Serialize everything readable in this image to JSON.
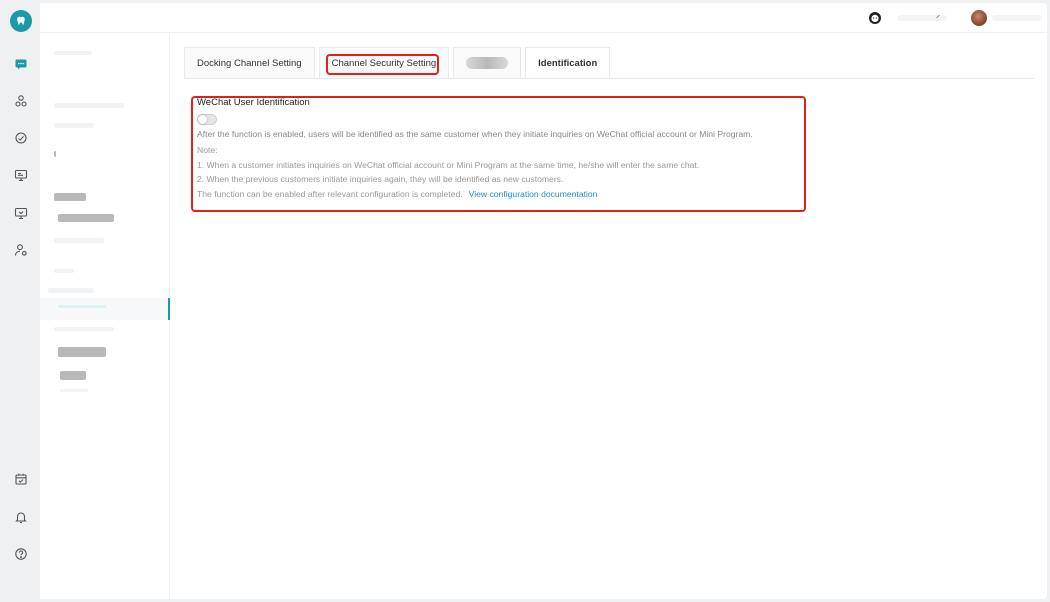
{
  "app": {
    "brand_color": "#1a9aa8",
    "highlight_color": "#e0201b"
  },
  "rail": {
    "icons": [
      "tooth-logo-icon",
      "chat-icon",
      "users-icon",
      "dashboard-icon",
      "monitor-icon",
      "screen-icon",
      "user-settings-icon",
      "calendar-icon",
      "bell-icon",
      "help-icon"
    ]
  },
  "tabs": [
    {
      "label": "Docking Channel Setting"
    },
    {
      "label": "Channel Security Setting"
    },
    {
      "label": ""
    },
    {
      "label": "Identification"
    }
  ],
  "section": {
    "title": "WeChat User Identification",
    "toggle_on": false,
    "description": "After the function is enabled, users will be identified as the same customer when they initiate inquiries on WeChat official account or Mini Program.",
    "note_label": "Note:",
    "notes": [
      "1. When a customer initiates inquiries on WeChat official account or Mini Program at the same time, he/she will enter the same chat.",
      "2. When the previous customers initiate inquiries again, they will be identified as new customers."
    ],
    "footer_text": "The function can be enabled after relevant configuration is completed.",
    "footer_link": "View configuration documentation"
  }
}
